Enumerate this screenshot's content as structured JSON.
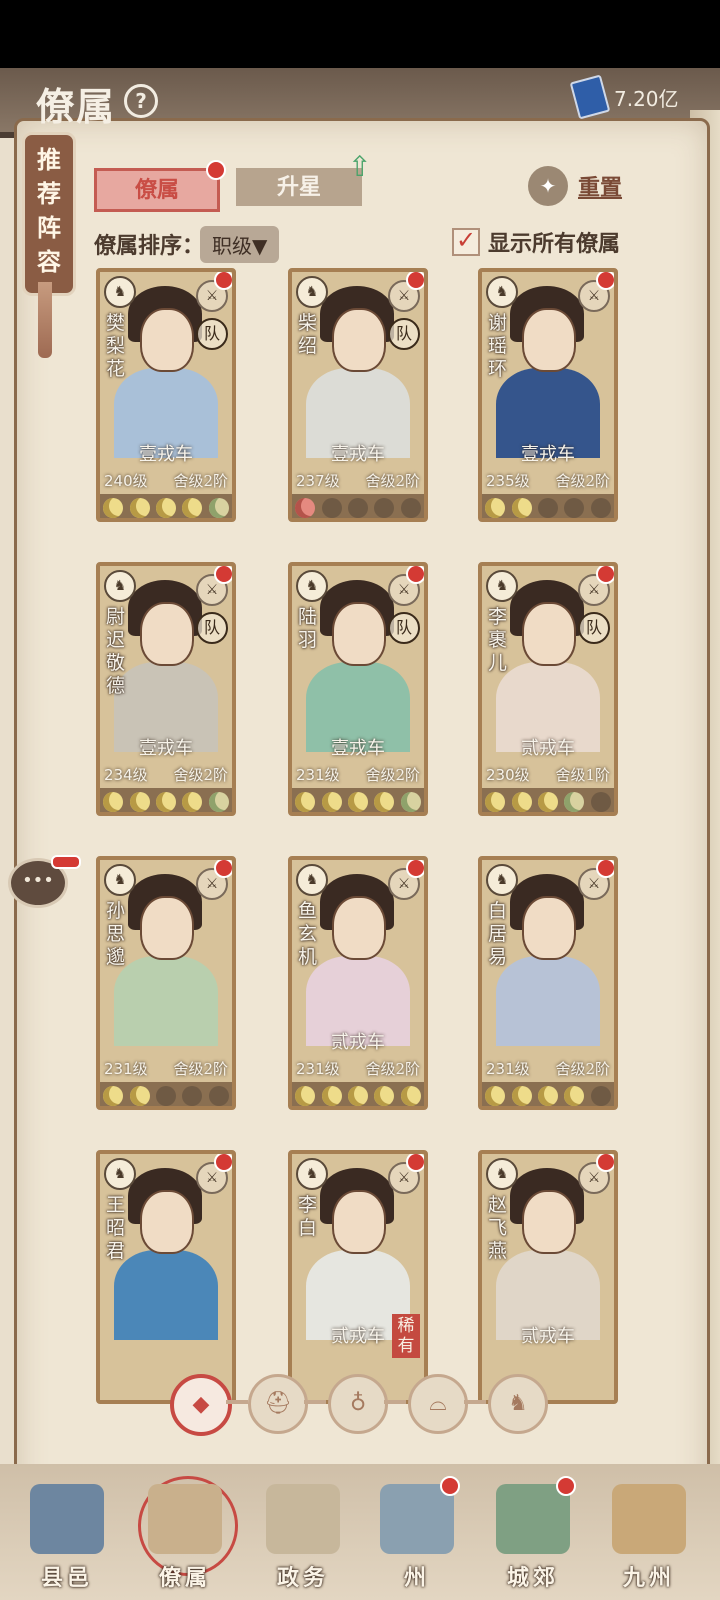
{
  "header": {
    "title": "僚属",
    "help_icon": "?",
    "currency_value": "7.20亿"
  },
  "recommend": {
    "chars": [
      "推",
      "荐",
      "阵",
      "容"
    ]
  },
  "tabs": [
    {
      "label": "僚属"
    },
    {
      "label": "升星"
    }
  ],
  "reset_label": "重置",
  "sort": {
    "label": "僚属排序：",
    "value": "职级▼"
  },
  "show_all": {
    "label": "显示所有僚属",
    "checked": true
  },
  "cards": [
    {
      "name": "樊梨花",
      "rank": "壹戎车",
      "level": "240级",
      "sub": "舍级2阶",
      "team": "队",
      "stars": [
        "on",
        "on",
        "on",
        "on",
        "half"
      ],
      "robe": "#a9c0d8"
    },
    {
      "name": "柴绍",
      "rank": "壹戎车",
      "level": "237级",
      "sub": "舍级2阶",
      "team": "队",
      "stars": [
        "red",
        "off",
        "off",
        "off",
        "off"
      ],
      "robe": "#dcdcd6"
    },
    {
      "name": "谢瑶环",
      "rank": "壹戎车",
      "level": "235级",
      "sub": "舍级2阶",
      "team": "",
      "stars": [
        "on",
        "on",
        "off",
        "off",
        "off"
      ],
      "robe": "#35558c"
    },
    {
      "name": "尉迟敬德",
      "rank": "壹戎车",
      "level": "234级",
      "sub": "舍级2阶",
      "team": "队",
      "stars": [
        "on",
        "on",
        "on",
        "on",
        "half"
      ],
      "robe": "#c9c3b6"
    },
    {
      "name": "陆羽",
      "rank": "壹戎车",
      "level": "231级",
      "sub": "舍级2阶",
      "team": "队",
      "stars": [
        "on",
        "on",
        "on",
        "on",
        "half"
      ],
      "robe": "#8fc0a8"
    },
    {
      "name": "李裹儿",
      "rank": "贰戎车",
      "level": "230级",
      "sub": "舍级1阶",
      "team": "队",
      "stars": [
        "on",
        "on",
        "on",
        "half",
        "off"
      ],
      "robe": "#e8d9cc"
    },
    {
      "name": "孙思邈",
      "rank": "",
      "level": "231级",
      "sub": "舍级2阶",
      "team": "",
      "stars": [
        "on",
        "on",
        "off",
        "off",
        "off"
      ],
      "robe": "#b9cfae"
    },
    {
      "name": "鱼玄机",
      "rank": "贰戎车",
      "level": "231级",
      "sub": "舍级2阶",
      "team": "",
      "stars": [
        "on",
        "on",
        "on",
        "on",
        "on"
      ],
      "robe": "#e6d0d8"
    },
    {
      "name": "白居易",
      "rank": "",
      "level": "231级",
      "sub": "舍级2阶",
      "team": "",
      "stars": [
        "on",
        "on",
        "on",
        "on",
        "off"
      ],
      "robe": "#b7c2d6"
    },
    {
      "name": "王昭君",
      "rank": "",
      "level": "",
      "sub": "",
      "team": "",
      "stars": [],
      "robe": "#4b87b8"
    },
    {
      "name": "李白",
      "rank": "贰戎车",
      "level": "",
      "sub": "",
      "team": "",
      "rare": "稀有",
      "stars": [],
      "robe": "#e6e6e0"
    },
    {
      "name": "赵飞燕",
      "rank": "贰戎车",
      "level": "",
      "sub": "",
      "team": "",
      "stars": [],
      "robe": "#e0d6c8"
    }
  ],
  "nav": [
    {
      "label": "县邑"
    },
    {
      "label": "僚属"
    },
    {
      "label": "政务"
    },
    {
      "label": "州"
    },
    {
      "label": "城郊"
    },
    {
      "label": "九州"
    }
  ]
}
